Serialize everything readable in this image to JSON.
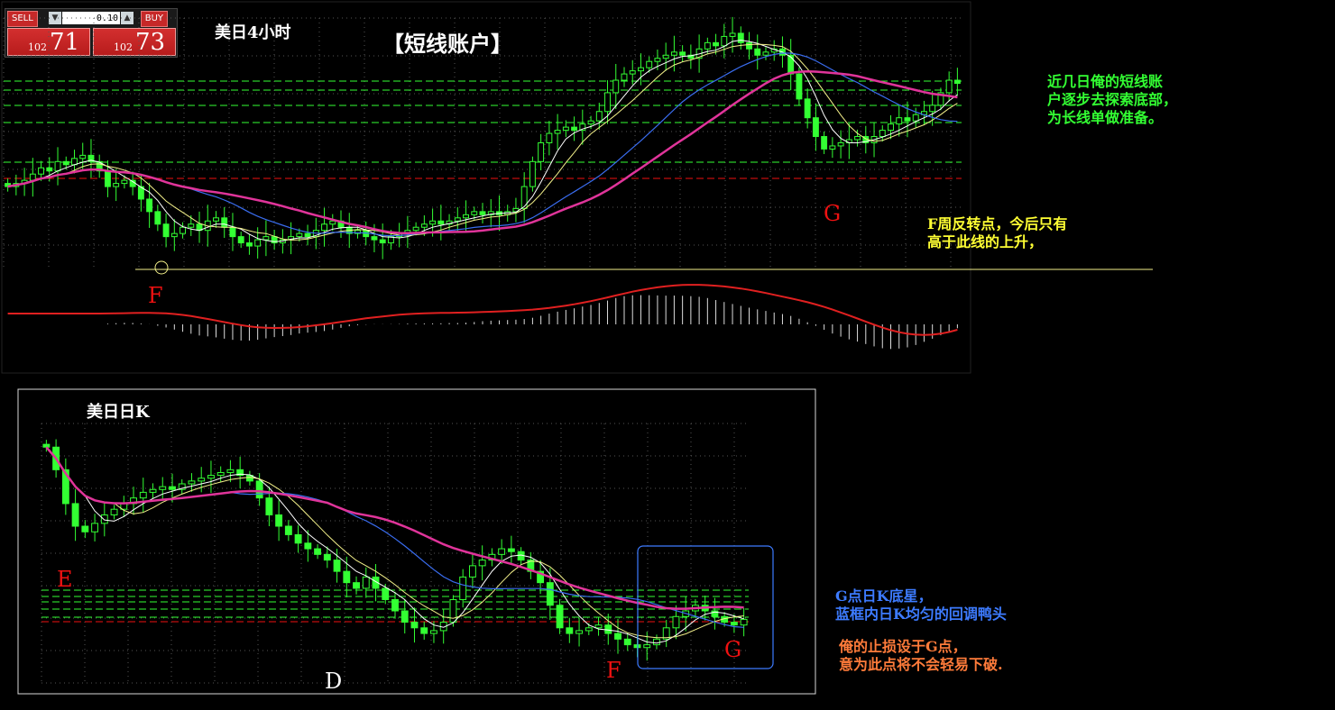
{
  "trade_panel": {
    "sell_label": "SELL",
    "buy_label": "BUY",
    "lot_value": "0.10",
    "sell_price_small": "102",
    "sell_price_big": "71",
    "buy_price_small": "102",
    "buy_price_big": "73",
    "lot_down_icon": "chevron-down-icon",
    "lot_up_icon": "chevron-up-icon"
  },
  "chart_top": {
    "title_period": "美日4小时",
    "title_account": "【短线账户】",
    "marker_f": "F",
    "marker_g": "G",
    "note_green": [
      "近几日俺的短线账",
      "户逐步去探索底部，",
      "为长线单做准备。"
    ],
    "note_yellow": [
      "F周反转点，今后只有",
      "高于此线的上升，"
    ]
  },
  "chart_bottom": {
    "title": "美日日K",
    "marker_e": "E",
    "marker_d": "D",
    "marker_f": "F",
    "marker_g": "G",
    "note_blue": [
      "G点日K底星，",
      "蓝框内日K均匀的回调鸭头"
    ],
    "note_orange": [
      "俺的止损设于G点，",
      "意为此点将不会轻易下破."
    ]
  },
  "colors": {
    "candle": "#33ff33",
    "ma_magenta": "#e0349a",
    "ma_blue": "#3a6df0",
    "ma_white": "#ffffff",
    "ma_yellow": "#f3f08a",
    "note_green": "#33ff33",
    "note_yellow": "#ffff33",
    "note_blue": "#3d7bff",
    "note_orange": "#ff7b3a",
    "marker_red": "#ee1111",
    "macd_line": "#e02020"
  },
  "chart_data": [
    {
      "type": "candlestick",
      "name": "USDJPY H4",
      "title": "美日4小时",
      "closes": [
        101.9,
        101.95,
        102.0,
        102.1,
        102.2,
        102.15,
        102.3,
        102.25,
        102.35,
        102.4,
        102.3,
        102.15,
        101.9,
        101.95,
        102.0,
        101.9,
        101.7,
        101.5,
        101.3,
        101.1,
        101.15,
        101.25,
        101.3,
        101.2,
        101.35,
        101.4,
        101.25,
        101.1,
        101.0,
        100.95,
        101.05,
        101.1,
        101.0,
        101.05,
        101.1,
        101.15,
        101.1,
        101.2,
        101.3,
        101.35,
        101.25,
        101.15,
        101.2,
        101.1,
        101.05,
        101.0,
        101.1,
        101.15,
        101.2,
        101.25,
        101.3,
        101.35,
        101.3,
        101.35,
        101.4,
        101.45,
        101.5,
        101.45,
        101.5,
        101.45,
        101.5,
        101.55,
        101.9,
        102.3,
        102.6,
        102.75,
        102.8,
        102.85,
        102.8,
        102.9,
        102.95,
        103.1,
        103.4,
        103.6,
        103.7,
        103.75,
        103.8,
        103.9,
        103.95,
        104.0,
        104.05,
        104.0,
        103.95,
        104.1,
        104.2,
        104.15,
        104.3,
        104.35,
        104.2,
        104.1,
        104.0,
        104.05,
        104.1,
        104.0,
        103.7,
        103.3,
        103.0,
        102.7,
        102.5,
        102.55,
        102.6,
        102.65,
        102.7,
        102.6,
        102.7,
        102.8,
        102.9,
        103.0,
        102.95,
        103.05,
        103.1,
        103.2,
        103.4,
        103.6,
        103.55
      ],
      "ma_series": [
        "white",
        "yellow",
        "blue",
        "magenta"
      ],
      "horizontal_levels_note": "F周反转点"
    },
    {
      "type": "candlestick",
      "name": "USDJPY Daily",
      "title": "美日日K",
      "closes": [
        105.0,
        104.6,
        104.0,
        103.6,
        103.5,
        103.65,
        103.8,
        103.9,
        104.0,
        104.1,
        104.2,
        104.25,
        104.3,
        104.25,
        104.35,
        104.4,
        104.45,
        104.5,
        104.55,
        104.6,
        104.5,
        104.4,
        104.1,
        103.8,
        103.6,
        103.45,
        103.3,
        103.2,
        103.1,
        103.0,
        102.8,
        102.6,
        102.5,
        102.7,
        102.5,
        102.3,
        102.1,
        101.9,
        101.8,
        101.7,
        101.75,
        101.9,
        102.3,
        102.7,
        102.9,
        103.0,
        103.1,
        103.2,
        103.15,
        103.0,
        102.8,
        102.6,
        102.2,
        101.8,
        101.7,
        101.75,
        101.8,
        101.85,
        101.7,
        101.6,
        101.5,
        101.45,
        101.5,
        101.6,
        101.8,
        102.0,
        102.1,
        102.2,
        102.1,
        102.0,
        101.9,
        101.85,
        101.95
      ],
      "markers": [
        "E",
        "D",
        "F",
        "G"
      ]
    }
  ]
}
